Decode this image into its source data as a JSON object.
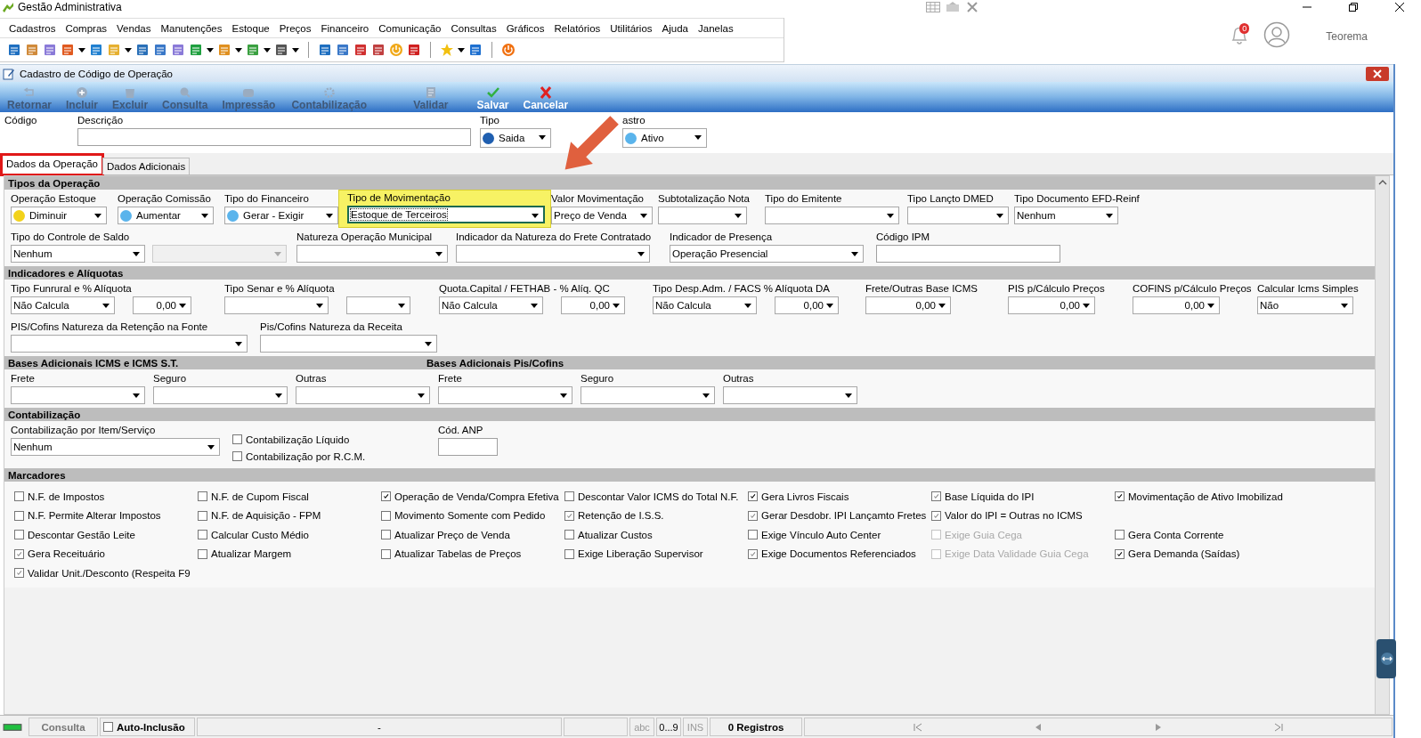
{
  "app": {
    "title": "Gestão Administrativa",
    "menu": [
      "Cadastros",
      "Compras",
      "Vendas",
      "Manutenções",
      "Estoque",
      "Preços",
      "Financeiro",
      "Comunicação",
      "Consultas",
      "Gráficos",
      "Relatórios",
      "Utilitários",
      "Ajuda",
      "Janelas"
    ],
    "notifications": "0",
    "user": "Teorema"
  },
  "window": {
    "title": "Cadastro de Código de Operação",
    "toolbar": [
      {
        "label": "Retornar",
        "kind": "back",
        "disabled": true
      },
      {
        "label": "Incluir",
        "kind": "add",
        "disabled": true
      },
      {
        "label": "Excluir",
        "kind": "delete",
        "disabled": true
      },
      {
        "label": "Consulta",
        "kind": "search",
        "disabled": true
      },
      {
        "label": "Impressão",
        "kind": "print",
        "disabled": true
      },
      {
        "label": "Contabilização",
        "kind": "gear",
        "disabled": true
      },
      {
        "label": "Validar",
        "kind": "validate",
        "disabled": true
      },
      {
        "label": "Salvar",
        "kind": "save",
        "disabled": false
      },
      {
        "label": "Cancelar",
        "kind": "cancel",
        "disabled": false
      }
    ]
  },
  "header": [
    {
      "label": "Código"
    },
    {
      "label": "Descrição",
      "controls": [
        {
          "kind": "text"
        }
      ]
    },
    {
      "label": "Tipo",
      "controls": [
        {
          "kind": "combo",
          "value": "Saida",
          "color": "#1f5fb0"
        }
      ]
    },
    {
      "label": "astro",
      "controls": [
        {
          "kind": "combo",
          "value": "Ativo",
          "color": "#5ab4ec"
        }
      ]
    }
  ],
  "tabs": [
    {
      "label": "Dados da Operação",
      "selected": true,
      "highlighted": true
    },
    {
      "label": "Dados Adicionais",
      "selected": false,
      "highlighted": false
    }
  ],
  "sections": [
    {
      "titles": [
        "Tipos da Operação"
      ],
      "lines": [
        [
          {
            "label": "Operação Estoque",
            "highlighted": false,
            "controls": [
              {
                "kind": "combo",
                "value": "Diminuir",
                "color": "#f2d21a"
              }
            ]
          },
          {
            "label": "Operação Comissão",
            "highlighted": false,
            "controls": [
              {
                "kind": "combo",
                "value": "Aumentar",
                "color": "#5ab4ec"
              }
            ]
          },
          {
            "label": "Tipo do Financeiro",
            "highlighted": false,
            "controls": [
              {
                "kind": "combo",
                "value": "Gerar - Exigir",
                "color": "#5ab4ec"
              }
            ]
          },
          {
            "label": "Tipo de Movimentação",
            "highlighted": true,
            "controls": [
              {
                "kind": "combo",
                "value": "Estoque de Terceiros"
              }
            ]
          },
          {
            "label": "Valor Movimentação",
            "highlighted": false,
            "controls": [
              {
                "kind": "combo",
                "value": "Preço de Venda"
              }
            ]
          },
          {
            "label": "Subtotalização Nota",
            "highlighted": false,
            "controls": [
              {
                "kind": "combo"
              }
            ]
          },
          {
            "label": "Tipo do Emitente",
            "highlighted": false,
            "controls": [
              {
                "kind": "combo"
              }
            ]
          },
          {
            "label": "Tipo Lançto DMED",
            "highlighted": false,
            "controls": [
              {
                "kind": "combo"
              }
            ]
          },
          {
            "label": "Tipo Documento EFD-Reinf",
            "highlighted": false,
            "controls": [
              {
                "kind": "combo",
                "value": "Nenhum"
              }
            ]
          }
        ],
        [
          {
            "label": "Tipo do Controle de Saldo",
            "controls": [
              {
                "kind": "combo",
                "value": "Nenhum"
              }
            ]
          },
          {
            "controls": [
              {
                "kind": "locked"
              }
            ]
          },
          {
            "label": "Natureza Operação Municipal",
            "controls": [
              {
                "kind": "combo"
              }
            ]
          },
          {
            "label": "Indicador da Natureza do Frete Contratado",
            "controls": [
              {
                "kind": "combo"
              }
            ]
          },
          {
            "label": "Indicador de Presença",
            "controls": [
              {
                "kind": "combo",
                "value": "Operação Presencial"
              }
            ]
          },
          {
            "label": "Código IPM",
            "controls": [
              {
                "kind": "text"
              }
            ]
          }
        ]
      ]
    },
    {
      "titles": [
        "Indicadores e Alíquotas"
      ],
      "lines": [
        [
          {
            "label": "Tipo Funrural e % Alíquota",
            "controls": [
              {
                "kind": "combo",
                "value": "Não Calcula"
              },
              {
                "kind": "number",
                "value": "0,00"
              }
            ]
          },
          {
            "label": "Tipo Senar e % Alíquota",
            "controls": [
              {
                "kind": "combo"
              },
              {
                "kind": "number"
              }
            ]
          },
          {
            "label": "Quota.Capital / FETHAB - % Alíq. QC",
            "controls": [
              {
                "kind": "combo",
                "value": "Não Calcula"
              },
              {
                "kind": "number",
                "value": "0,00"
              }
            ]
          },
          {
            "label": "Tipo Desp.Adm. / FACS % Alíquota DA",
            "controls": [
              {
                "kind": "combo",
                "value": "Não Calcula"
              },
              {
                "kind": "number",
                "value": "0,00"
              }
            ]
          },
          {
            "label": "Frete/Outras Base ICMS",
            "controls": [
              {
                "kind": "number",
                "value": "0,00"
              }
            ]
          },
          {
            "label": "PIS p/Cálculo Preços",
            "controls": [
              {
                "kind": "number",
                "value": "0,00"
              }
            ]
          },
          {
            "label": "COFINS p/Cálculo Preços",
            "controls": [
              {
                "kind": "number",
                "value": "0,00"
              }
            ]
          },
          {
            "label": "Calcular Icms Simples",
            "controls": [
              {
                "kind": "combo",
                "value": "Não"
              }
            ]
          }
        ],
        [
          {
            "label": "PIS/Cofins Natureza da Retenção na Fonte",
            "controls": [
              {
                "kind": "combo"
              }
            ]
          },
          {
            "label": "Pis/Cofins Natureza da Receita",
            "controls": [
              {
                "kind": "combo"
              }
            ]
          }
        ]
      ]
    },
    {
      "titles": [
        "Bases Adicionais ICMS e ICMS S.T.",
        "Bases Adicionais Pis/Cofins"
      ],
      "lines": [
        [
          {
            "label": "Frete",
            "controls": [
              {
                "kind": "combo"
              }
            ]
          },
          {
            "label": "Seguro",
            "controls": [
              {
                "kind": "combo"
              }
            ]
          },
          {
            "label": "Outras",
            "controls": [
              {
                "kind": "combo"
              }
            ]
          },
          {
            "label": "Frete",
            "controls": [
              {
                "kind": "combo"
              }
            ]
          },
          {
            "label": "Seguro",
            "controls": [
              {
                "kind": "combo"
              }
            ]
          },
          {
            "label": "Outras",
            "controls": [
              {
                "kind": "combo"
              }
            ]
          }
        ]
      ]
    },
    {
      "titles": [
        "Contabilização"
      ],
      "lines": [
        [
          {
            "label": "Contabilização por Item/Serviço",
            "controls": [
              {
                "kind": "combo",
                "value": "Nenhum"
              }
            ]
          },
          {
            "controls": [
              {
                "kind": "checks",
                "items": [
                  {
                    "label": "Contabilização Líquido",
                    "checked": false
                  },
                  {
                    "label": "Contabilização por R.C.M.",
                    "checked": false
                  }
                ]
              }
            ]
          },
          {
            "label": "Cód. ANP",
            "controls": [
              {
                "kind": "text"
              }
            ]
          }
        ]
      ]
    },
    {
      "titles": [
        "Marcadores"
      ],
      "checkboxes": [
        [
          {
            "label": "N.F. de Impostos",
            "checked": false,
            "disabled": false
          },
          {
            "label": "N.F. de Cupom Fiscal",
            "checked": false,
            "disabled": false
          },
          {
            "label": "Operação de Venda/Compra Efetiva",
            "checked": true,
            "grayed": false,
            "disabled": false
          },
          {
            "label": "Descontar Valor ICMS do Total N.F.",
            "checked": false,
            "disabled": false
          },
          {
            "label": "Gera Livros Fiscais",
            "checked": true,
            "grayed": false,
            "disabled": false
          },
          {
            "label": "Base Líquida do IPI",
            "checked": true,
            "grayed": true,
            "disabled": false
          },
          {
            "label": "Movimentação de Ativo Imobilizad",
            "checked": true,
            "grayed": false,
            "disabled": false
          }
        ],
        [
          {
            "label": "N.F. Permite Alterar Impostos",
            "checked": false,
            "disabled": false
          },
          {
            "label": "N.F. de Aquisição - FPM",
            "checked": false,
            "disabled": false
          },
          {
            "label": "Movimento Somente com Pedido",
            "checked": false,
            "disabled": false
          },
          {
            "label": "Retenção de I.S.S.",
            "checked": true,
            "grayed": true,
            "disabled": false
          },
          {
            "label": "Gerar Desdobr. IPI Lançamto Fretes",
            "checked": true,
            "grayed": true,
            "disabled": false
          },
          {
            "label": "Valor do IPI = Outras no ICMS",
            "checked": true,
            "grayed": true,
            "disabled": false
          }
        ],
        [
          {
            "label": "Descontar Gestão Leite",
            "checked": false,
            "disabled": false
          },
          {
            "label": "Calcular Custo Médio",
            "checked": false,
            "disabled": false
          },
          {
            "label": "Atualizar Preço de Venda",
            "checked": false,
            "disabled": false
          },
          {
            "label": "Atualizar Custos",
            "checked": false,
            "disabled": false
          },
          {
            "label": "Exige Vínculo Auto Center",
            "checked": false,
            "disabled": false
          },
          {
            "label": "Exige Guia Cega",
            "checked": false,
            "disabled": true
          },
          {
            "label": "Gera Conta Corrente",
            "checked": false,
            "disabled": false
          }
        ],
        [
          {
            "label": "Gera Receituário",
            "checked": true,
            "grayed": true,
            "disabled": false
          },
          {
            "label": "Atualizar Margem",
            "checked": false,
            "disabled": false
          },
          {
            "label": "Atualizar Tabelas de Preços",
            "checked": false,
            "disabled": false
          },
          {
            "label": "Exige Liberação Supervisor",
            "checked": false,
            "disabled": false
          },
          {
            "label": "Exige Documentos Referenciados",
            "checked": true,
            "grayed": true,
            "disabled": false
          },
          {
            "label": "Exige Data Validade Guia Cega",
            "checked": false,
            "disabled": true
          },
          {
            "label": "Gera Demanda (Saídas)",
            "checked": true,
            "grayed": false,
            "disabled": false
          }
        ],
        [
          {
            "label": "Validar Unit./Desconto (Respeita F9",
            "checked": true,
            "grayed": true,
            "disabled": false
          }
        ]
      ]
    }
  ],
  "status_bar": {
    "mode": "Consulta",
    "auto_inclusion": {
      "label": "Auto-Inclusão",
      "checked": false
    },
    "message": "-",
    "indicators": [
      {
        "label": "abc",
        "active": false
      },
      {
        "label": "0...9",
        "active": true
      },
      {
        "label": "INS",
        "active": false
      }
    ],
    "records": "0 Registros"
  }
}
